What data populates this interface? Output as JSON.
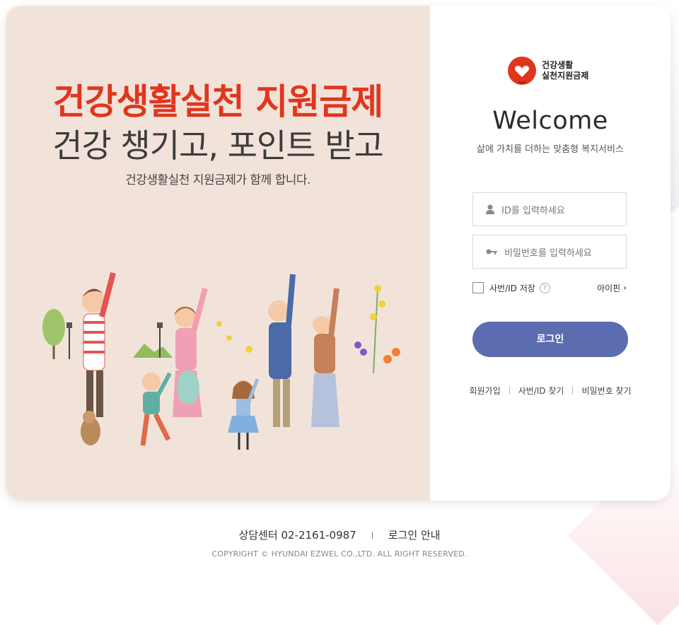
{
  "hero": {
    "headline_red": "건강생활실천 지원금제",
    "headline_dark": "건강 챙기고, 포인트 받고",
    "subline": "건강생활실천 지원금제가 함께 합니다."
  },
  "login": {
    "logo_line1": "건강생활",
    "logo_line2": "실천지원금제",
    "welcome": "Welcome",
    "tagline": "삶에 가치를 더하는 맞춤형 복지서비스",
    "id_placeholder": "ID를 입력하세요",
    "pw_placeholder": "비밀번호를 입력하세요",
    "save_label": "사번/ID 저장",
    "help_mark": "?",
    "ipin_label": "아이핀",
    "ipin_chevron": "›",
    "login_button": "로그인",
    "links": [
      "회원가입",
      "사번/ID 찾기",
      "비밀번호 찾기"
    ]
  },
  "footer": {
    "contact": "상담센터 02-2161-0987",
    "login_guide": "로그인 안내",
    "copyright": "COPYRIGHT © HYUNDAI EZWEL CO.,LTD. ALL RIGHT RESERVED."
  },
  "colors": {
    "accent_red": "#e0361e",
    "button_blue": "#5b6cb1",
    "hero_bg": "#f2e3da"
  }
}
